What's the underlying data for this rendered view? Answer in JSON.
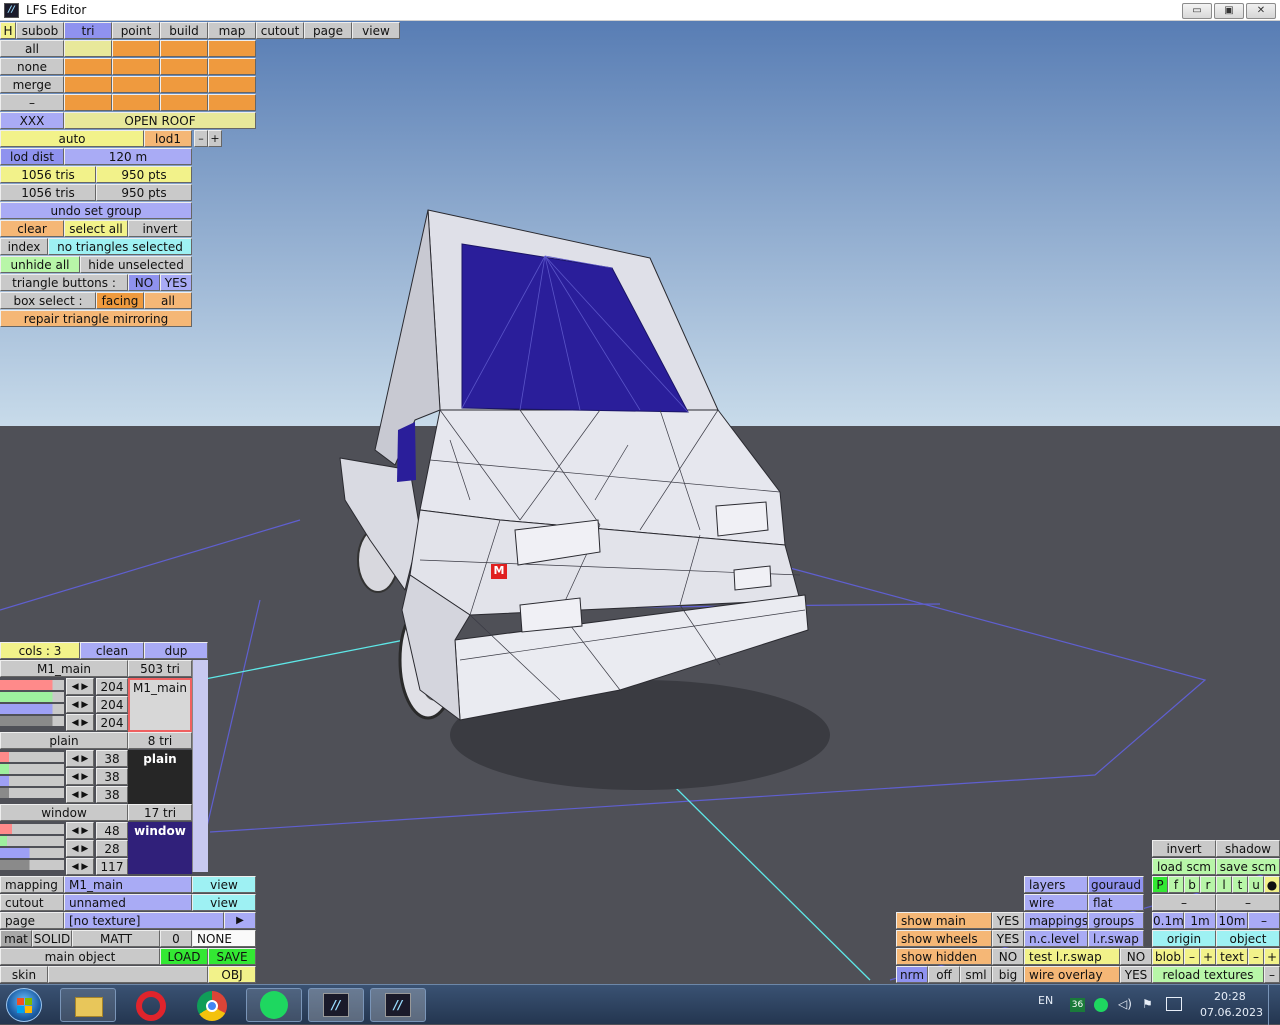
{
  "window": {
    "title": "LFS Editor",
    "controls": [
      "▭",
      "▣",
      "✕"
    ]
  },
  "menu": {
    "items": [
      "H",
      "subob",
      "tri",
      "point",
      "build",
      "map",
      "cutout",
      "page",
      "view"
    ],
    "active": "tri"
  },
  "selection": {
    "rows": [
      "all",
      "none",
      "merge",
      "–"
    ],
    "xxx": "XXX",
    "group": "OPEN ROOF",
    "auto": "auto",
    "lod": "lod1",
    "minus": "–",
    "plus": "+"
  },
  "stats": {
    "lod_dist_label": "lod dist",
    "lod_dist_value": "120 m",
    "tris_1": "1056 tris",
    "pts_1": "950 pts",
    "tris_2": "1056 tris",
    "pts_2": "950 pts"
  },
  "tri_panel": {
    "undo": "undo set group",
    "clear": "clear",
    "select_all": "select all",
    "invert": "invert",
    "index": "index",
    "no_selected": "no triangles selected",
    "unhide_all": "unhide all",
    "hide_unselected": "hide unselected",
    "triangle_buttons": "triangle buttons :",
    "no": "NO",
    "yes": "YES",
    "box_select": "box select :",
    "facing": "facing",
    "all": "all",
    "repair": "repair triangle mirroring"
  },
  "colours": {
    "cols": "cols : 3",
    "clean": "clean",
    "dup": "dup",
    "materials": [
      {
        "name": "M1_main",
        "tris": "503 tri",
        "r": "204",
        "g": "204",
        "b": "204",
        "preview": "M1_main"
      },
      {
        "name": "plain",
        "tris": "8 tri",
        "r": "38",
        "g": "38",
        "b": "38",
        "preview": "plain"
      },
      {
        "name": "window",
        "tris": "17 tri",
        "r": "48",
        "g": "28",
        "b": "117",
        "preview": "window"
      }
    ]
  },
  "mapping_panel": {
    "mapping_label": "mapping",
    "mapping_value": "M1_main",
    "cutout_label": "cutout",
    "cutout_value": "unnamed",
    "page_label": "page",
    "page_value": "[no texture]",
    "view": "view",
    "arrow": "▶",
    "mat": "mat",
    "solid": "SOLID",
    "matt": "MATT",
    "zero": "0",
    "none": "NONE",
    "main_object": "main object",
    "load": "LOAD",
    "save": "SAVE",
    "skin": "skin",
    "obj": "OBJ"
  },
  "view_panel": {
    "invert": "invert",
    "shadow": "shadow",
    "load_scm": "load scm",
    "save_scm": "save scm",
    "layers": "layers",
    "gouraud": "gouraud",
    "layer_letters": [
      "P",
      "f",
      "b",
      "r",
      "l",
      "t",
      "u",
      "●"
    ],
    "wire": "wire",
    "flat": "flat",
    "dash": "–",
    "show_main": "show main",
    "show_main_v": "YES",
    "mappings": "mappings",
    "groups": "groups",
    "grid_01": "0.1m",
    "grid_1": "1m",
    "grid_10": "10m",
    "show_wheels": "show wheels",
    "show_wheels_v": "YES",
    "nc_level": "n.c.level",
    "lr_swap": "l.r.swap",
    "origin": "origin",
    "object": "object",
    "show_hidden": "show hidden",
    "show_hidden_v": "NO",
    "test_swap": "test l.r.swap",
    "test_swap_v": "NO",
    "blob": "blob",
    "text": "text",
    "nrm": "nrm",
    "off": "off",
    "sml": "sml",
    "big": "big",
    "wire_overlay": "wire overlay",
    "wire_overlay_v": "YES",
    "reload": "reload textures",
    "minus": "–",
    "plus": "+"
  },
  "scene": {
    "marker": "M",
    "colors": {
      "sky_top": "#5a80b8",
      "sky_bottom": "#c4d8e8",
      "ground": "#4f5057",
      "body": "#e6e7ee",
      "window": "#2a1e9a"
    }
  },
  "taskbar": {
    "lang": "EN",
    "badge": "36",
    "time": "20:28",
    "date": "07.06.2023",
    "apps": [
      "start-orb-icon",
      "file-explorer-icon",
      "opera-icon",
      "chrome-icon",
      "spotify-icon",
      "lfs-icon",
      "lfs-editor-icon"
    ]
  }
}
